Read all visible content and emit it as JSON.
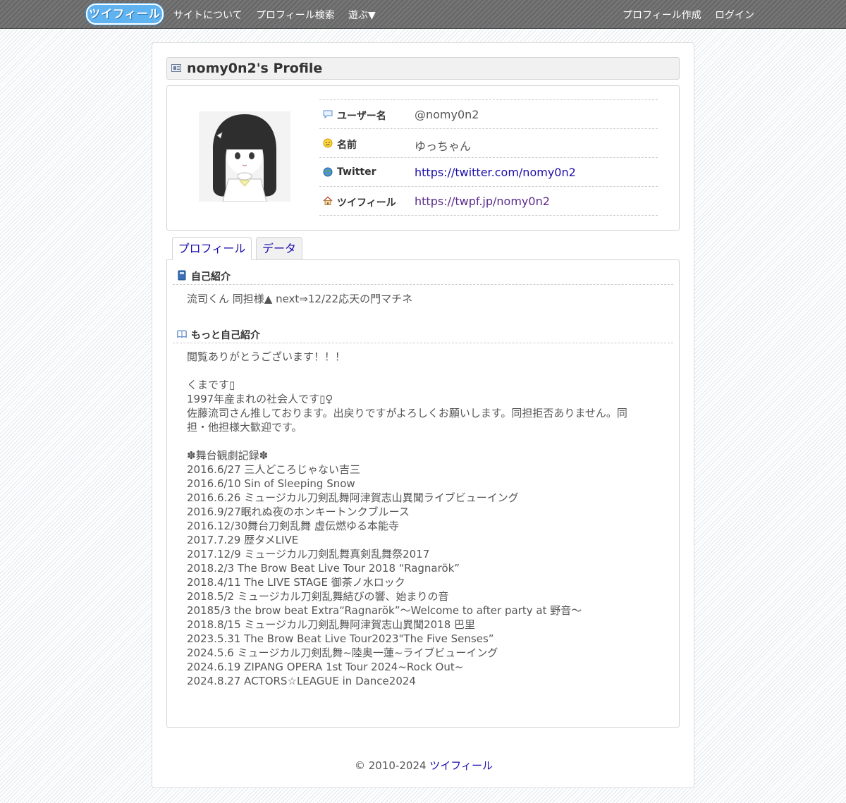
{
  "nav": {
    "logo": "ツイフィール",
    "left_items": [
      "サイトについて",
      "プロフィール検索",
      "遊ぶ▼"
    ],
    "right_items": [
      "プロフィール作成",
      "ログイン"
    ]
  },
  "profile": {
    "title": "nomy0n2's Profile",
    "rows": [
      {
        "icon": "speech-bubble-icon",
        "label": "ユーザー名",
        "value": "@nomy0n2"
      },
      {
        "icon": "smiley-icon",
        "label": "名前",
        "value": "ゆっちゃん"
      },
      {
        "icon": "globe-icon",
        "label": "Twitter",
        "value": "https://twitter.com/nomy0n2"
      },
      {
        "icon": "house-icon",
        "label": "ツイフィール",
        "value": "https://twpf.jp/nomy0n2"
      }
    ]
  },
  "tabs": [
    "プロフィール",
    "データ"
  ],
  "sections": {
    "intro": {
      "title": "自己紹介",
      "text": "流司くん 同担様▲ next⇒12/22応天の門マチネ"
    },
    "more": {
      "title": "もっと自己紹介",
      "text": "閲覧ありがとうございます！！！\n\nくまです▯\n1997年産まれの社会人です▯♀\n佐藤流司さん推しております。出戻りですがよろしくお願いします。同担拒否ありません。同\n担・他担様大歓迎です。\n\n✽舞台観劇記録✽\n2016.6/27 三人どころじゃない吉三\n2016.6/10 Sin of Sleeping Snow\n2016.6.26 ミュージカル刀剣乱舞阿津賀志山異聞ライブビューイング\n2016.9/27眠れぬ夜のホンキートンクブルース\n2016.12/30舞台刀剣乱舞 虚伝燃ゆる本能寺\n2017.7.29 歴タメLIVE\n2017.12/9 ミュージカル刀剣乱舞真剣乱舞祭2017\n2018.2/3 The Brow Beat Live Tour 2018 “Ragnarök”\n2018.4/11 The LIVE STAGE 御茶ノ水ロック\n2018.5/2 ミュージカル刀剣乱舞結びの響、始まりの音\n20185/3 the brow beat Extra“Ragnarök”〜Welcome to after party at 野音〜\n2018.8/15 ミュージカル刀剣乱舞阿津賀志山異聞2018 巴里\n2023.5.31 The Brow Beat Live Tour2023\"The Five Senses”\n2024.5.6 ミュージカル刀剣乱舞~陸奥一蓮~ライブビューイング\n2024.6.19 ZIPANG OPERA 1st Tour 2024~Rock Out~\n2024.8.27 ACTORS☆LEAGUE in Dance2024"
    }
  },
  "footer": {
    "copyright": "© 2010-2024 ",
    "link": "ツイフィール"
  }
}
